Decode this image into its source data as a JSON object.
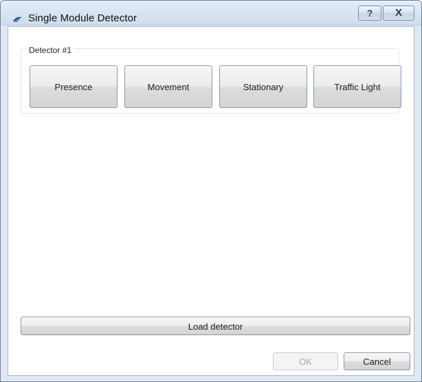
{
  "window": {
    "title": "Single Module Detector",
    "help_label": "?",
    "close_label": "X",
    "app_icon": "app-icon"
  },
  "detector_group": {
    "title": "Detector #1",
    "buttons": [
      {
        "label": "Presence"
      },
      {
        "label": "Movement"
      },
      {
        "label": "Stationary"
      },
      {
        "label": "Traffic Light"
      }
    ]
  },
  "actions": {
    "load_detector_label": "Load detector",
    "ok_label": "OK",
    "cancel_label": "Cancel",
    "ok_enabled": false
  },
  "colors": {
    "titlebar_bg": "#dfe8f2",
    "window_border": "#6f7f95",
    "client_bg": "#ffffff",
    "disabled_text": "#a7a7a7"
  }
}
